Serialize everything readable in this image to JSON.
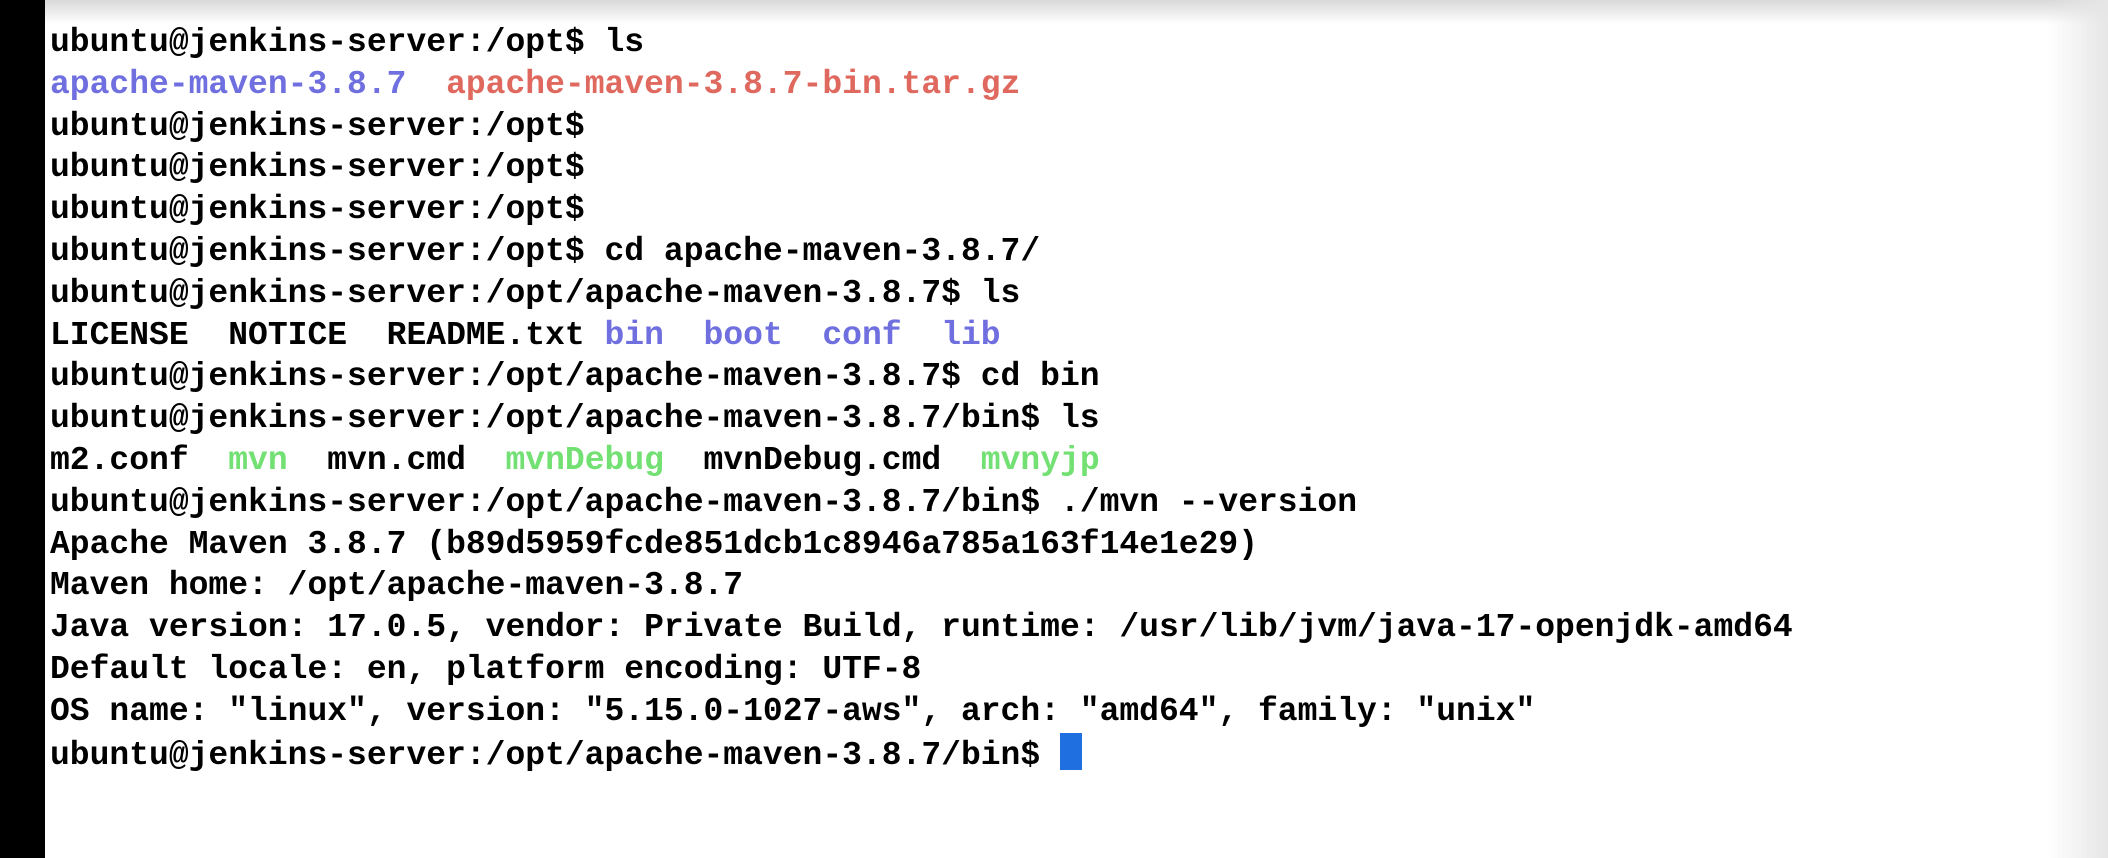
{
  "colors": {
    "background": "#ffffff",
    "text": "#000000",
    "directory": "#6f6fdf",
    "archive": "#e0695f",
    "executable": "#73e073",
    "cursor": "#1f6fe0"
  },
  "terminal": {
    "lines": [
      [
        {
          "text": "ubuntu@jenkins-server:/opt$ ls",
          "role": "prompt"
        }
      ],
      [
        {
          "text": "apache-maven-3.8.7",
          "role": "directory"
        },
        {
          "text": "  ",
          "role": "plain"
        },
        {
          "text": "apache-maven-3.8.7-bin.tar.gz",
          "role": "archive"
        }
      ],
      [
        {
          "text": "ubuntu@jenkins-server:/opt$",
          "role": "prompt"
        }
      ],
      [
        {
          "text": "ubuntu@jenkins-server:/opt$",
          "role": "prompt"
        }
      ],
      [
        {
          "text": "ubuntu@jenkins-server:/opt$",
          "role": "prompt"
        }
      ],
      [
        {
          "text": "ubuntu@jenkins-server:/opt$ cd apache-maven-3.8.7/",
          "role": "prompt"
        }
      ],
      [
        {
          "text": "ubuntu@jenkins-server:/opt/apache-maven-3.8.7$ ls",
          "role": "prompt"
        }
      ],
      [
        {
          "text": "LICENSE  NOTICE  README.txt ",
          "role": "plain"
        },
        {
          "text": "bin",
          "role": "directory"
        },
        {
          "text": "  ",
          "role": "plain"
        },
        {
          "text": "boot",
          "role": "directory"
        },
        {
          "text": "  ",
          "role": "plain"
        },
        {
          "text": "conf",
          "role": "directory"
        },
        {
          "text": "  ",
          "role": "plain"
        },
        {
          "text": "lib",
          "role": "directory"
        }
      ],
      [
        {
          "text": "ubuntu@jenkins-server:/opt/apache-maven-3.8.7$ cd bin",
          "role": "prompt"
        }
      ],
      [
        {
          "text": "ubuntu@jenkins-server:/opt/apache-maven-3.8.7/bin$ ls",
          "role": "prompt"
        }
      ],
      [
        {
          "text": "m2.conf  ",
          "role": "plain"
        },
        {
          "text": "mvn",
          "role": "executable"
        },
        {
          "text": "  mvn.cmd  ",
          "role": "plain"
        },
        {
          "text": "mvnDebug",
          "role": "executable"
        },
        {
          "text": "  mvnDebug.cmd  ",
          "role": "plain"
        },
        {
          "text": "mvnyjp",
          "role": "executable"
        }
      ],
      [
        {
          "text": "ubuntu@jenkins-server:/opt/apache-maven-3.8.7/bin$ ./mvn --version",
          "role": "prompt"
        }
      ],
      [
        {
          "text": "Apache Maven 3.8.7 (b89d5959fcde851dcb1c8946a785a163f14e1e29)",
          "role": "output"
        }
      ],
      [
        {
          "text": "Maven home: /opt/apache-maven-3.8.7",
          "role": "output"
        }
      ],
      [
        {
          "text": "Java version: 17.0.5, vendor: Private Build, runtime: /usr/lib/jvm/java-17-openjdk-amd64",
          "role": "output"
        }
      ],
      [
        {
          "text": "Default locale: en, platform encoding: UTF-8",
          "role": "output"
        }
      ],
      [
        {
          "text": "OS name: \"linux\", version: \"5.15.0-1027-aws\", arch: \"amd64\", family: \"unix\"",
          "role": "output"
        }
      ],
      [
        {
          "text": "ubuntu@jenkins-server:/opt/apache-maven-3.8.7/bin$ ",
          "role": "prompt"
        },
        {
          "text": "",
          "role": "cursor"
        }
      ]
    ]
  }
}
